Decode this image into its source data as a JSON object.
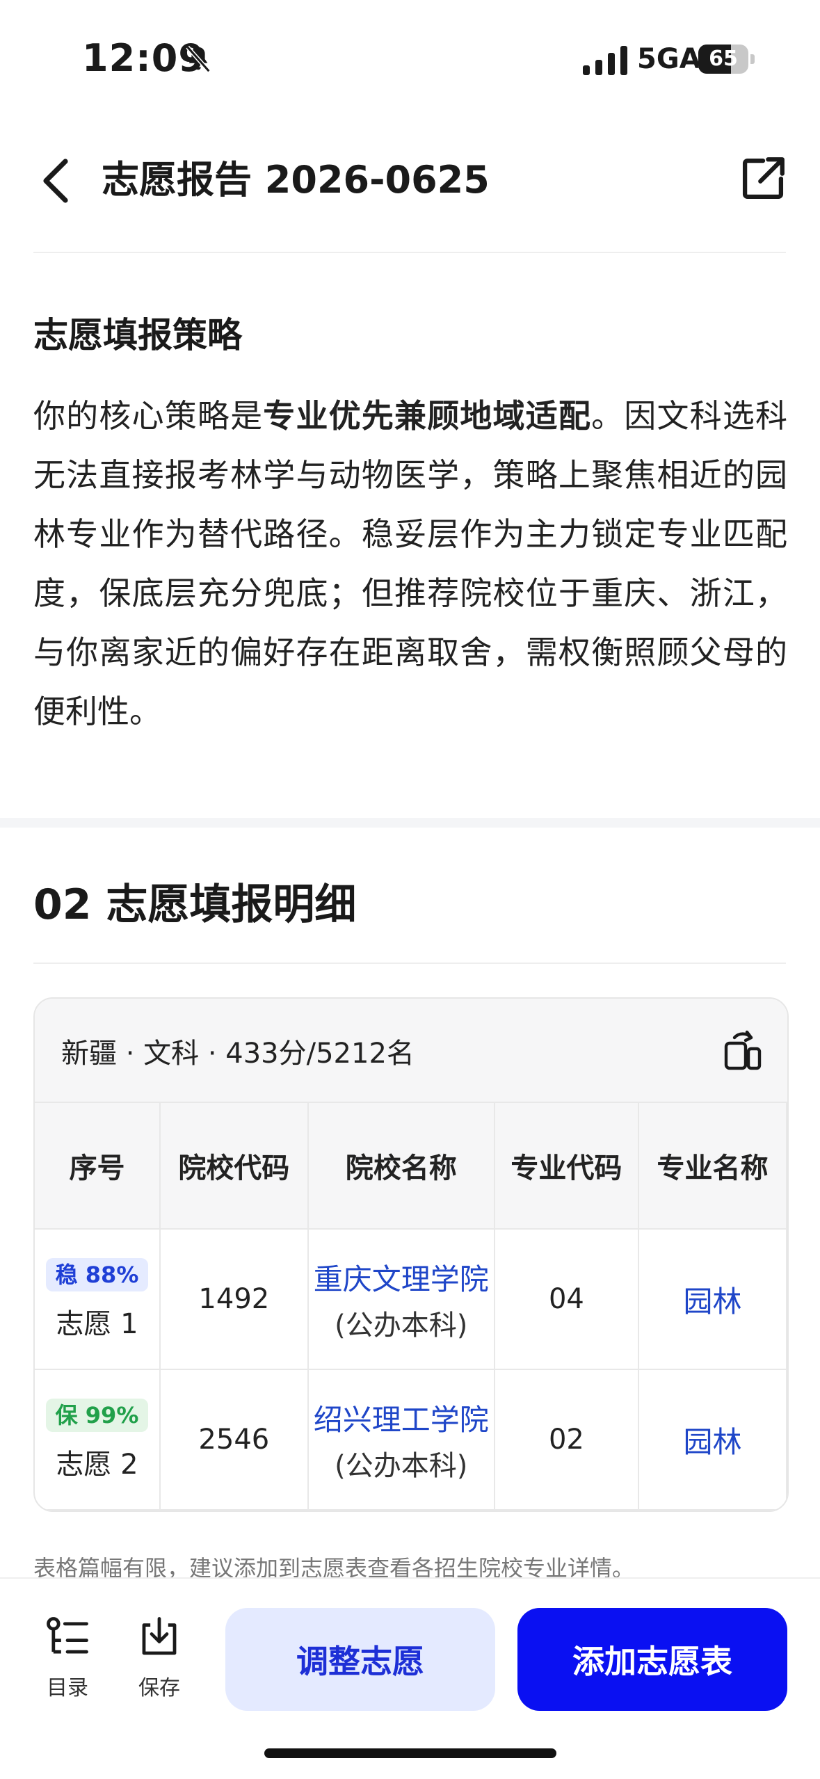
{
  "status": {
    "time": "12:09",
    "network": "5GA",
    "battery": "65",
    "battery_fraction": 0.65
  },
  "header": {
    "title": "志愿报告 2026-0625"
  },
  "strategy": {
    "title": "志愿填报策略",
    "text_before": "你的核心策略是",
    "highlight": "专业优先兼顾地域适配",
    "text_after": "。因文科选科无法直接报考林学与动物医学，策略上聚焦相近的园林专业作为替代路径。稳妥层作为主力锁定专业匹配度，保底层充分兜底；但推荐院校位于重庆、浙江，与你离家近的偏好存在距离取舍，需权衡照顾父母的便利性。"
  },
  "detail": {
    "title": "02 志愿填报明细",
    "summary": "新疆 · 文科 · 433分/5212名",
    "columns": [
      "序号",
      "院校代码",
      "院校名称",
      "专业代码",
      "专业名称"
    ],
    "rows": [
      {
        "badge": "稳 88%",
        "badge_color": "#1f3fd6",
        "choice": "志愿 1",
        "code": "1492",
        "school": "重庆文理学院",
        "type": "(公办本科)",
        "major_code": "04",
        "major": "园林"
      },
      {
        "badge": "保 99%",
        "badge_color": "#21a04a",
        "choice": "志愿 2",
        "code": "2546",
        "school": "绍兴理工学院",
        "type": "(公办本科)",
        "major_code": "02",
        "major": "园林"
      }
    ],
    "note": "表格篇幅有限，建议添加到志愿表查看各招生院校专业详情。"
  },
  "bottom": {
    "catalog": "目录",
    "save": "保存",
    "adjust": "调整志愿",
    "add": "添加志愿表",
    "accent": "#0a10f2"
  }
}
